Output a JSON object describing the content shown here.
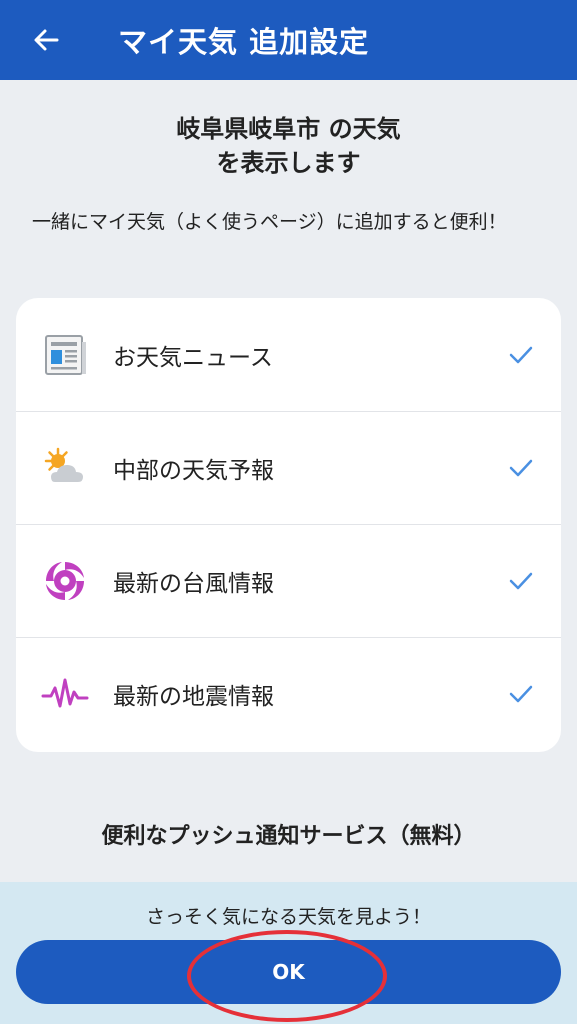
{
  "header": {
    "back_icon": "arrow-left-icon",
    "title": "マイ天気 追加設定"
  },
  "intro": {
    "title_line1": "岐阜県岐阜市 の天気",
    "title_line2": "を表示します",
    "description": "一緒にマイ天気（よく使うページ）に追加すると便利！"
  },
  "items": [
    {
      "icon": "newspaper-icon",
      "label": "お天気ニュース",
      "checked": true
    },
    {
      "icon": "sun-cloud-icon",
      "label": "中部の天気予報",
      "checked": true
    },
    {
      "icon": "typhoon-icon",
      "label": "最新の台風情報",
      "checked": true
    },
    {
      "icon": "seismic-wave-icon",
      "label": "最新の地震情報",
      "checked": true
    }
  ],
  "push": {
    "title": "便利なプッシュ通知サービス（無料）"
  },
  "bottom": {
    "prompt": "さっそく気になる天気を見よう！",
    "ok_label": "OK"
  },
  "colors": {
    "primary": "#1d5bbf",
    "check": "#4a90e2",
    "typhoon": "#c040c0",
    "annotation": "#e53038"
  }
}
